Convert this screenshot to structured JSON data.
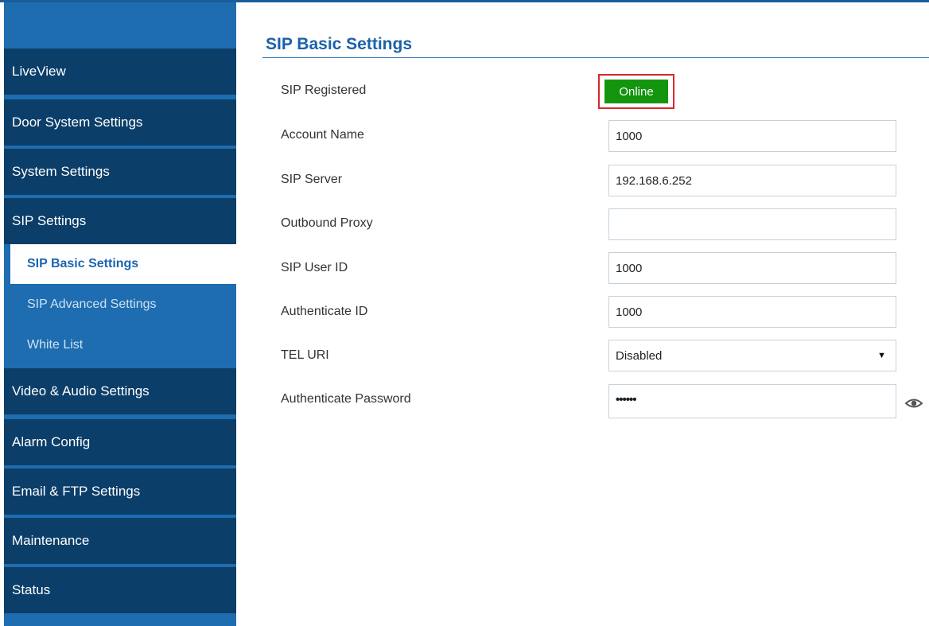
{
  "sidebar": {
    "main_items": [
      {
        "label": "LiveView"
      },
      {
        "label": "Door System Settings"
      },
      {
        "label": "System Settings"
      },
      {
        "label": "SIP Settings"
      },
      {
        "label": "Video & Audio Settings"
      },
      {
        "label": "Alarm Config"
      },
      {
        "label": "Email & FTP Settings"
      },
      {
        "label": "Maintenance"
      },
      {
        "label": "Status"
      }
    ],
    "sub_items": [
      {
        "label": "SIP Basic Settings",
        "active": true
      },
      {
        "label": "SIP Advanced Settings",
        "active": false
      },
      {
        "label": "White List",
        "active": false
      }
    ]
  },
  "page": {
    "title": "SIP Basic Settings"
  },
  "form": {
    "sip_registered": {
      "label": "SIP Registered",
      "status": "Online"
    },
    "account_name": {
      "label": "Account Name",
      "value": "1000"
    },
    "sip_server": {
      "label": "SIP Server",
      "value": "192.168.6.252"
    },
    "outbound_proxy": {
      "label": "Outbound Proxy",
      "value": ""
    },
    "sip_user_id": {
      "label": "SIP User ID",
      "value": "1000"
    },
    "authenticate_id": {
      "label": "Authenticate ID",
      "value": "1000"
    },
    "tel_uri": {
      "label": "TEL URI",
      "value": "Disabled"
    },
    "authenticate_password": {
      "label": "Authenticate Password",
      "value": "••••••"
    }
  },
  "icons": {
    "password_toggle": "eye-icon",
    "dropdown": "caret-down-icon"
  },
  "colors": {
    "sidebar_dark": "#0b3e69",
    "sidebar_blue": "#1e6db0",
    "title_blue": "#1b62a8",
    "online_green": "#13960d",
    "highlight_red": "#d9272e"
  }
}
